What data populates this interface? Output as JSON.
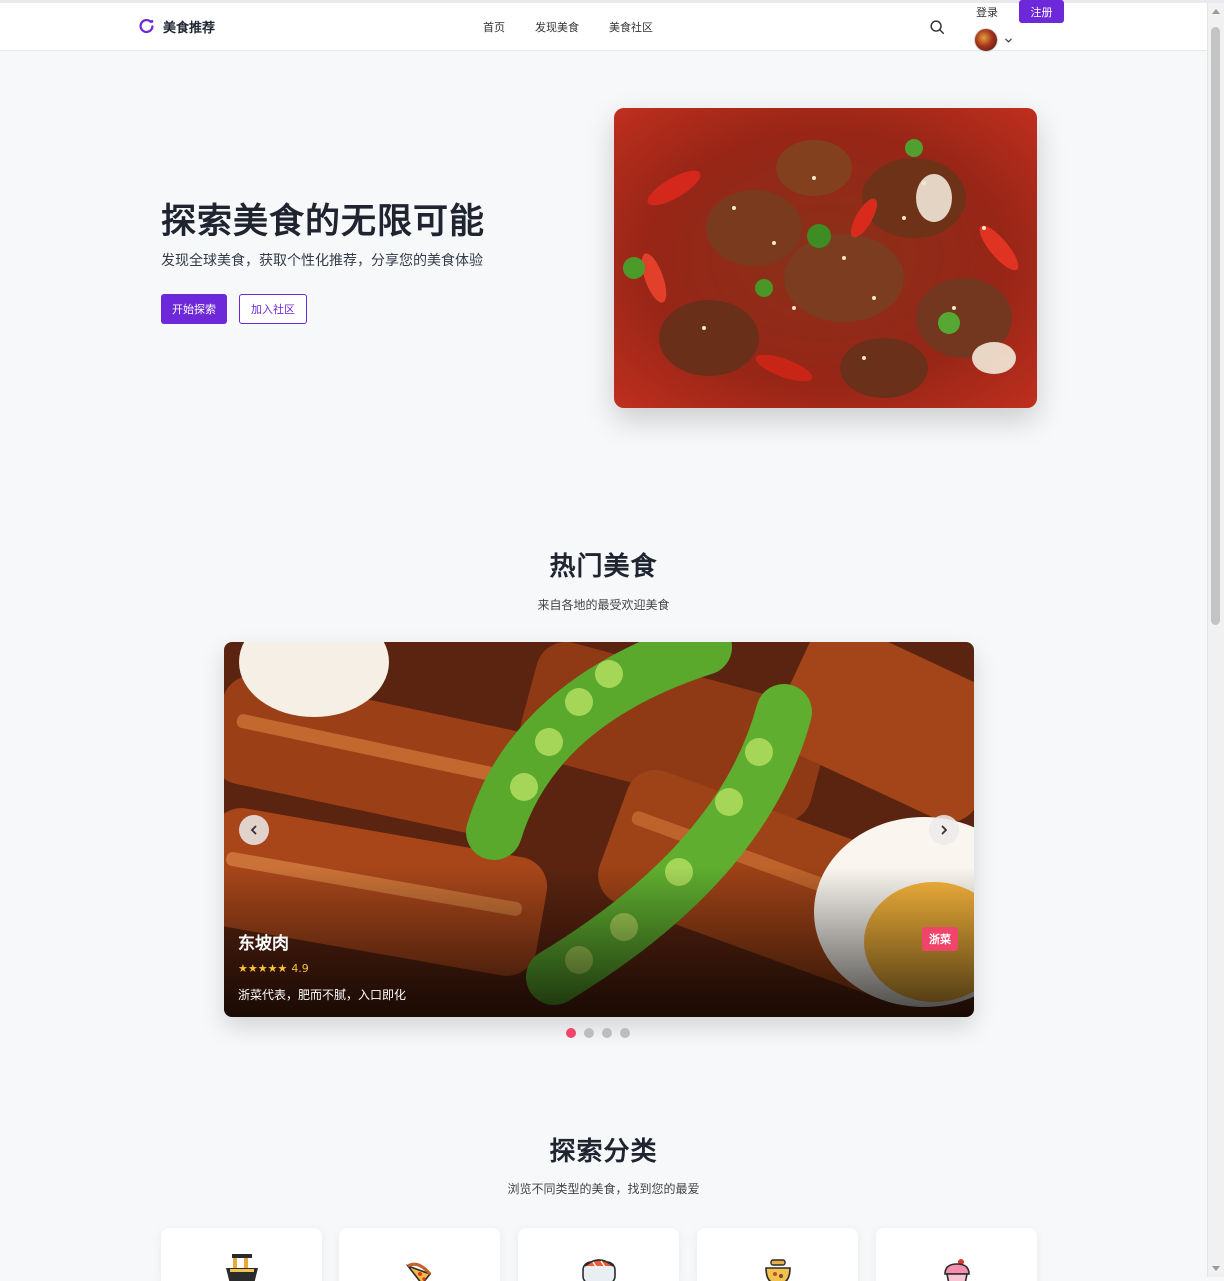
{
  "header": {
    "brand": "美食推荐",
    "nav": [
      "首页",
      "发现美食",
      "美食社区"
    ],
    "login": "登录",
    "register": "注册"
  },
  "hero": {
    "title": "探索美食的无限可能",
    "subtitle": "发现全球美食，获取个性化推荐，分享您的美食体验",
    "primary_button": "开始探索",
    "secondary_button": "加入社区"
  },
  "popular": {
    "title": "热门美食",
    "subtitle": "来自各地的最受欢迎美食",
    "slide": {
      "name": "东坡肉",
      "stars": "★★★★★",
      "rating": "4.9",
      "description": "浙菜代表，肥而不腻，入口即化",
      "tag": "浙菜"
    },
    "slide_count": 4,
    "active_slide": 1
  },
  "categories": {
    "title": "探索分类",
    "subtitle": "浏览不同类型的美食，找到您的最爱",
    "icons": [
      "noodles-icon",
      "pizza-icon",
      "sushi-icon",
      "soup-icon",
      "cupcake-icon"
    ]
  },
  "colors": {
    "accent": "#6d28d9",
    "tag": "#f0456b",
    "star": "#f8c23a",
    "background": "#f7f8fa"
  }
}
